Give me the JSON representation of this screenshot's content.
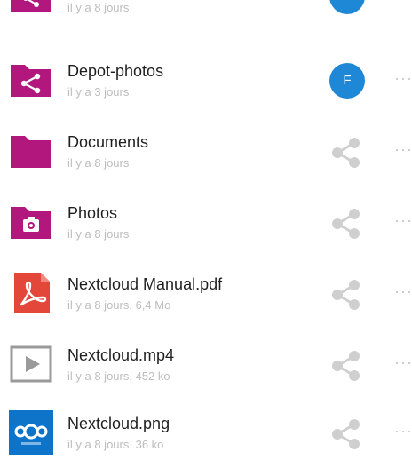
{
  "files": [
    {
      "name": "",
      "meta": "il y a 8 jours",
      "type": "shared-folder",
      "sharing": "avatar",
      "avatar_initial": ""
    },
    {
      "name": "Depot-photos",
      "meta": "il y a 3 jours",
      "type": "shared-folder",
      "sharing": "avatar",
      "avatar_initial": "F"
    },
    {
      "name": "Documents",
      "meta": "il y a 8 jours",
      "type": "folder",
      "sharing": "share"
    },
    {
      "name": "Photos",
      "meta": "il y a 8 jours",
      "type": "photo-folder",
      "sharing": "share"
    },
    {
      "name": "Nextcloud Manual.pdf",
      "meta": "il y a 8 jours, 6,4 Mo",
      "type": "pdf",
      "sharing": "share"
    },
    {
      "name": "Nextcloud.mp4",
      "meta": "il y a 8 jours, 452 ko",
      "type": "video",
      "sharing": "share"
    },
    {
      "name": "Nextcloud.png",
      "meta": "il y a 8 jours, 36 ko",
      "type": "image",
      "sharing": "share"
    }
  ],
  "more_label": "···",
  "colors": {
    "folder": "#b2177d",
    "avatar": "#1e88d6",
    "share_icon": "#cfcfcf",
    "pdf": "#e2473a",
    "image": "#0e74c9"
  }
}
